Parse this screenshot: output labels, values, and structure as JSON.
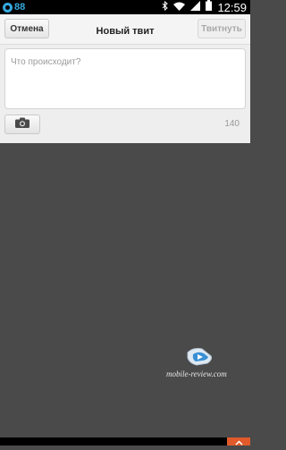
{
  "status_bar": {
    "notification_count": "88",
    "time": "12:59",
    "icons": [
      "notification-app-icon",
      "bluetooth-icon",
      "wifi-icon",
      "signal-icon",
      "battery-icon"
    ]
  },
  "action_bar": {
    "cancel_label": "Отмена",
    "title": "Новый твит",
    "tweet_label": "Твитнуть"
  },
  "compose": {
    "placeholder": "Что происходит?",
    "char_counter": "140",
    "attach_icon": "camera-icon"
  },
  "watermark": {
    "text": "mobile-review.com"
  },
  "bottom_bar": {
    "icon": "chevron-up-icon"
  },
  "colors": {
    "accent": "#35a9e0",
    "background": "#4a4a4a",
    "scroll_up": "#e05a2a"
  }
}
